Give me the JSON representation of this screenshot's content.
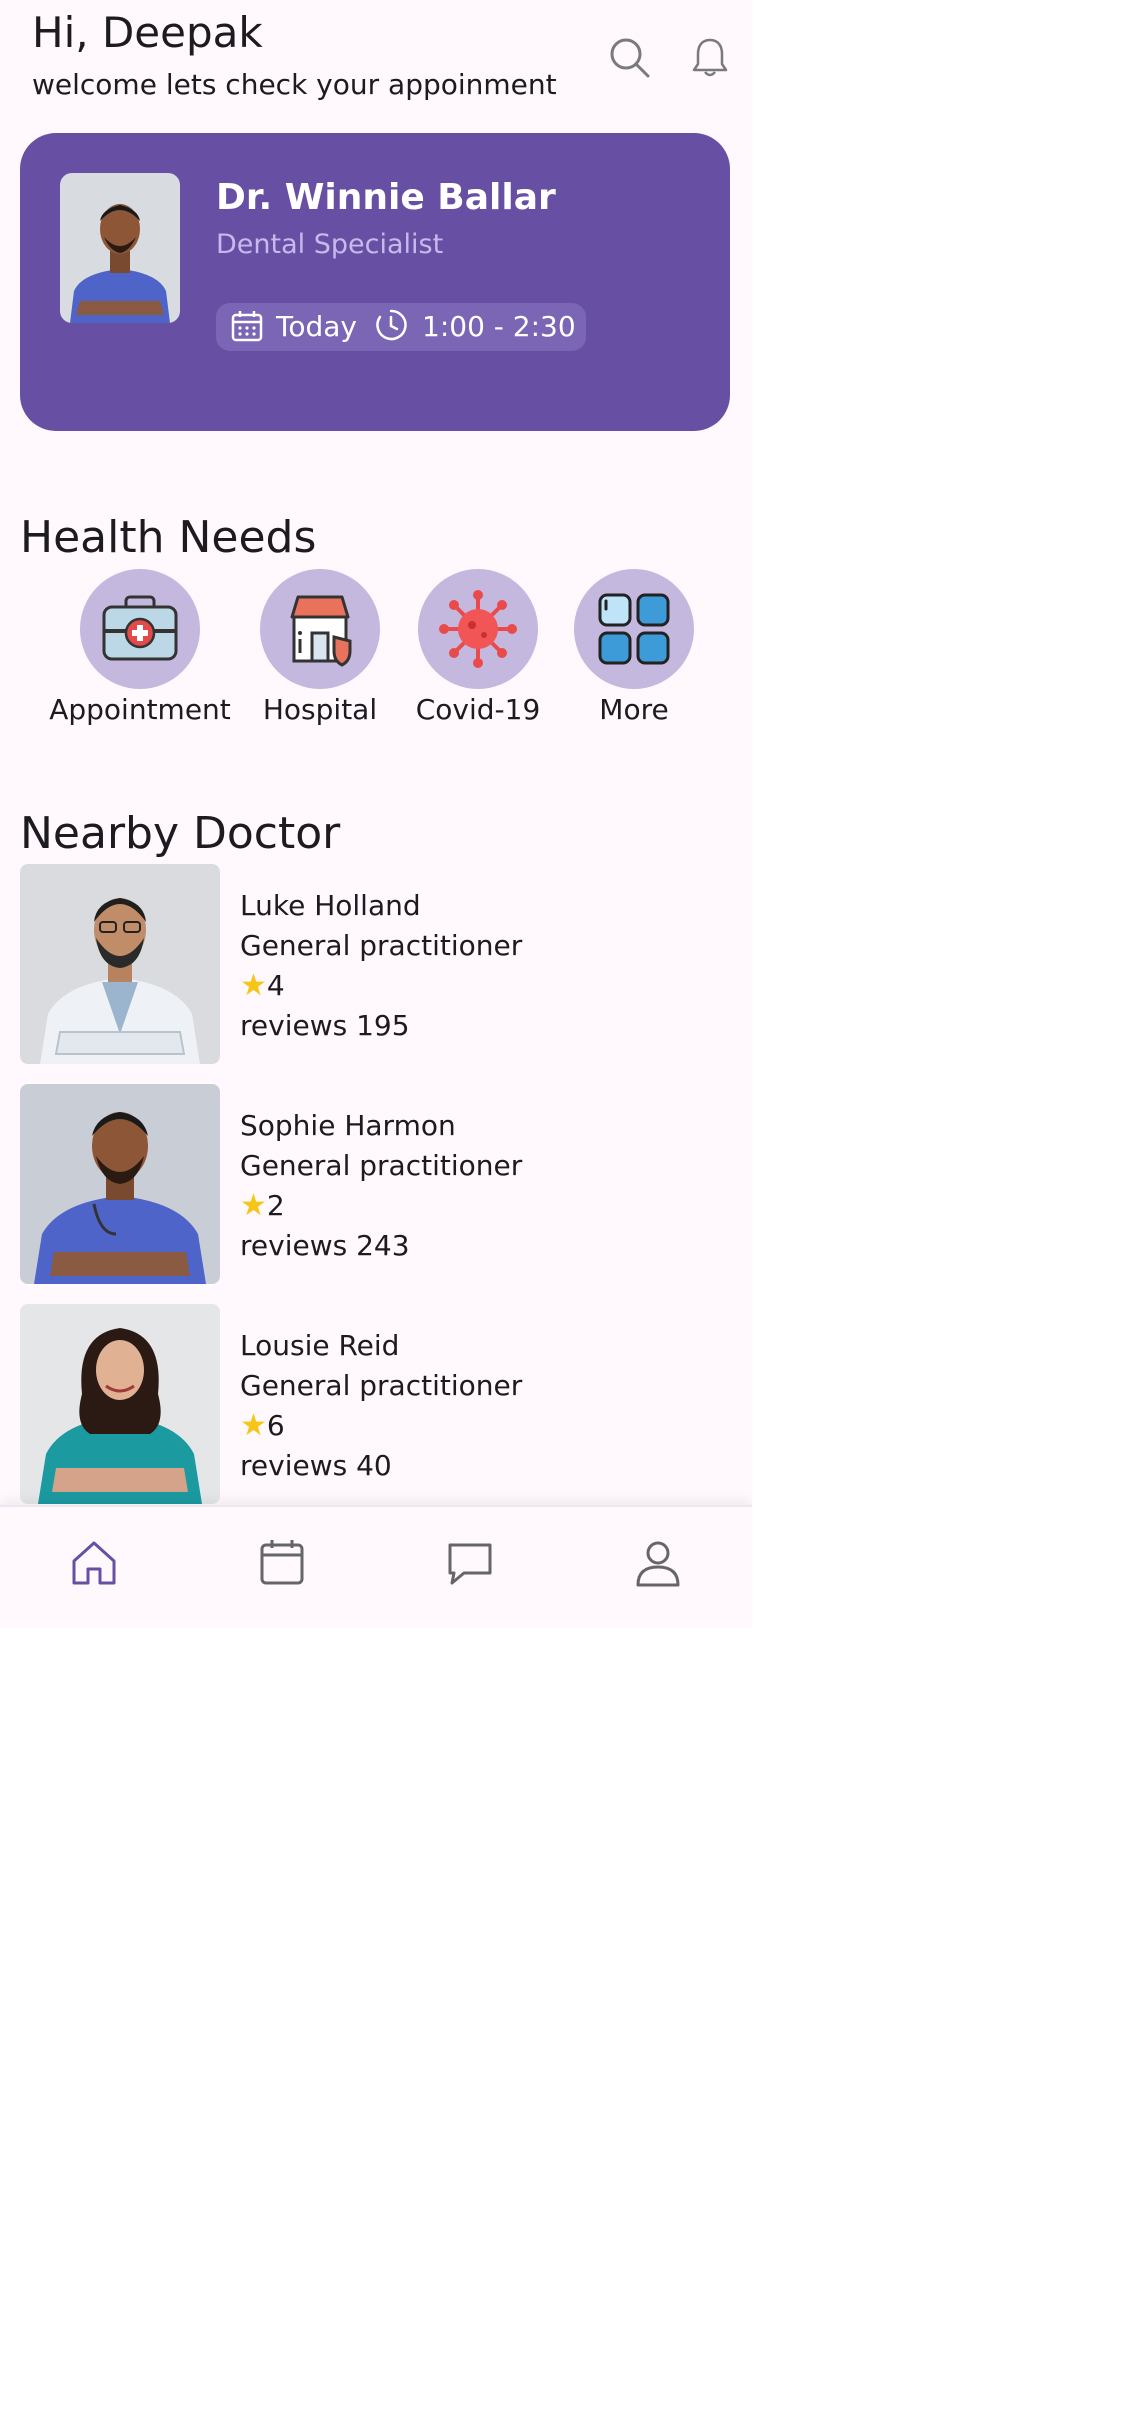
{
  "header": {
    "greeting": "Hi, Deepak",
    "subtitle": "welcome lets check your appoinment",
    "icons": [
      "search-icon",
      "bell-icon"
    ]
  },
  "appointment": {
    "doctor_name": "Dr. Winnie Ballar",
    "specialty": "Dental Specialist",
    "date": "Today",
    "time": "1:00 - 2:30",
    "card_color": "#6750a4"
  },
  "health_needs": {
    "title": "Health Needs",
    "items": [
      {
        "label": "Appointment",
        "icon": "medical-kit-icon"
      },
      {
        "label": "Hospital",
        "icon": "hospital-icon"
      },
      {
        "label": "Covid-19",
        "icon": "virus-icon"
      },
      {
        "label": "More",
        "icon": "grid-icon"
      }
    ]
  },
  "nearby": {
    "title": "Nearby Doctor",
    "doctors": [
      {
        "name": "Luke Holland",
        "role": "General practitioner",
        "rating": "4",
        "reviews": "reviews 195"
      },
      {
        "name": "Sophie Harmon",
        "role": "General practitioner",
        "rating": "2",
        "reviews": "reviews 243"
      },
      {
        "name": "Lousie Reid",
        "role": "General practitioner",
        "rating": "6",
        "reviews": "reviews 40"
      }
    ]
  },
  "bottom_nav": {
    "items": [
      "home-icon",
      "calendar-icon",
      "chat-icon",
      "profile-icon"
    ],
    "active_color": "#6750a4"
  }
}
